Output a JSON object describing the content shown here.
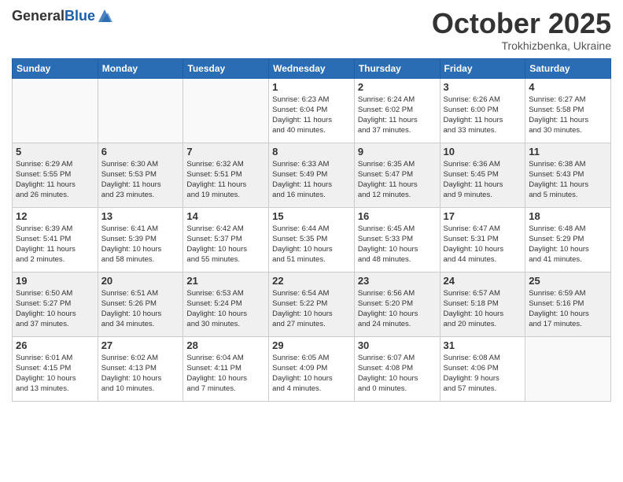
{
  "header": {
    "logo_general": "General",
    "logo_blue": "Blue",
    "month_title": "October 2025",
    "subtitle": "Trokhizbenka, Ukraine"
  },
  "weekdays": [
    "Sunday",
    "Monday",
    "Tuesday",
    "Wednesday",
    "Thursday",
    "Friday",
    "Saturday"
  ],
  "weeks": [
    [
      {
        "day": "",
        "info": ""
      },
      {
        "day": "",
        "info": ""
      },
      {
        "day": "",
        "info": ""
      },
      {
        "day": "1",
        "info": "Sunrise: 6:23 AM\nSunset: 6:04 PM\nDaylight: 11 hours\nand 40 minutes."
      },
      {
        "day": "2",
        "info": "Sunrise: 6:24 AM\nSunset: 6:02 PM\nDaylight: 11 hours\nand 37 minutes."
      },
      {
        "day": "3",
        "info": "Sunrise: 6:26 AM\nSunset: 6:00 PM\nDaylight: 11 hours\nand 33 minutes."
      },
      {
        "day": "4",
        "info": "Sunrise: 6:27 AM\nSunset: 5:58 PM\nDaylight: 11 hours\nand 30 minutes."
      }
    ],
    [
      {
        "day": "5",
        "info": "Sunrise: 6:29 AM\nSunset: 5:55 PM\nDaylight: 11 hours\nand 26 minutes."
      },
      {
        "day": "6",
        "info": "Sunrise: 6:30 AM\nSunset: 5:53 PM\nDaylight: 11 hours\nand 23 minutes."
      },
      {
        "day": "7",
        "info": "Sunrise: 6:32 AM\nSunset: 5:51 PM\nDaylight: 11 hours\nand 19 minutes."
      },
      {
        "day": "8",
        "info": "Sunrise: 6:33 AM\nSunset: 5:49 PM\nDaylight: 11 hours\nand 16 minutes."
      },
      {
        "day": "9",
        "info": "Sunrise: 6:35 AM\nSunset: 5:47 PM\nDaylight: 11 hours\nand 12 minutes."
      },
      {
        "day": "10",
        "info": "Sunrise: 6:36 AM\nSunset: 5:45 PM\nDaylight: 11 hours\nand 9 minutes."
      },
      {
        "day": "11",
        "info": "Sunrise: 6:38 AM\nSunset: 5:43 PM\nDaylight: 11 hours\nand 5 minutes."
      }
    ],
    [
      {
        "day": "12",
        "info": "Sunrise: 6:39 AM\nSunset: 5:41 PM\nDaylight: 11 hours\nand 2 minutes."
      },
      {
        "day": "13",
        "info": "Sunrise: 6:41 AM\nSunset: 5:39 PM\nDaylight: 10 hours\nand 58 minutes."
      },
      {
        "day": "14",
        "info": "Sunrise: 6:42 AM\nSunset: 5:37 PM\nDaylight: 10 hours\nand 55 minutes."
      },
      {
        "day": "15",
        "info": "Sunrise: 6:44 AM\nSunset: 5:35 PM\nDaylight: 10 hours\nand 51 minutes."
      },
      {
        "day": "16",
        "info": "Sunrise: 6:45 AM\nSunset: 5:33 PM\nDaylight: 10 hours\nand 48 minutes."
      },
      {
        "day": "17",
        "info": "Sunrise: 6:47 AM\nSunset: 5:31 PM\nDaylight: 10 hours\nand 44 minutes."
      },
      {
        "day": "18",
        "info": "Sunrise: 6:48 AM\nSunset: 5:29 PM\nDaylight: 10 hours\nand 41 minutes."
      }
    ],
    [
      {
        "day": "19",
        "info": "Sunrise: 6:50 AM\nSunset: 5:27 PM\nDaylight: 10 hours\nand 37 minutes."
      },
      {
        "day": "20",
        "info": "Sunrise: 6:51 AM\nSunset: 5:26 PM\nDaylight: 10 hours\nand 34 minutes."
      },
      {
        "day": "21",
        "info": "Sunrise: 6:53 AM\nSunset: 5:24 PM\nDaylight: 10 hours\nand 30 minutes."
      },
      {
        "day": "22",
        "info": "Sunrise: 6:54 AM\nSunset: 5:22 PM\nDaylight: 10 hours\nand 27 minutes."
      },
      {
        "day": "23",
        "info": "Sunrise: 6:56 AM\nSunset: 5:20 PM\nDaylight: 10 hours\nand 24 minutes."
      },
      {
        "day": "24",
        "info": "Sunrise: 6:57 AM\nSunset: 5:18 PM\nDaylight: 10 hours\nand 20 minutes."
      },
      {
        "day": "25",
        "info": "Sunrise: 6:59 AM\nSunset: 5:16 PM\nDaylight: 10 hours\nand 17 minutes."
      }
    ],
    [
      {
        "day": "26",
        "info": "Sunrise: 6:01 AM\nSunset: 4:15 PM\nDaylight: 10 hours\nand 13 minutes."
      },
      {
        "day": "27",
        "info": "Sunrise: 6:02 AM\nSunset: 4:13 PM\nDaylight: 10 hours\nand 10 minutes."
      },
      {
        "day": "28",
        "info": "Sunrise: 6:04 AM\nSunset: 4:11 PM\nDaylight: 10 hours\nand 7 minutes."
      },
      {
        "day": "29",
        "info": "Sunrise: 6:05 AM\nSunset: 4:09 PM\nDaylight: 10 hours\nand 4 minutes."
      },
      {
        "day": "30",
        "info": "Sunrise: 6:07 AM\nSunset: 4:08 PM\nDaylight: 10 hours\nand 0 minutes."
      },
      {
        "day": "31",
        "info": "Sunrise: 6:08 AM\nSunset: 4:06 PM\nDaylight: 9 hours\nand 57 minutes."
      },
      {
        "day": "",
        "info": ""
      }
    ]
  ]
}
